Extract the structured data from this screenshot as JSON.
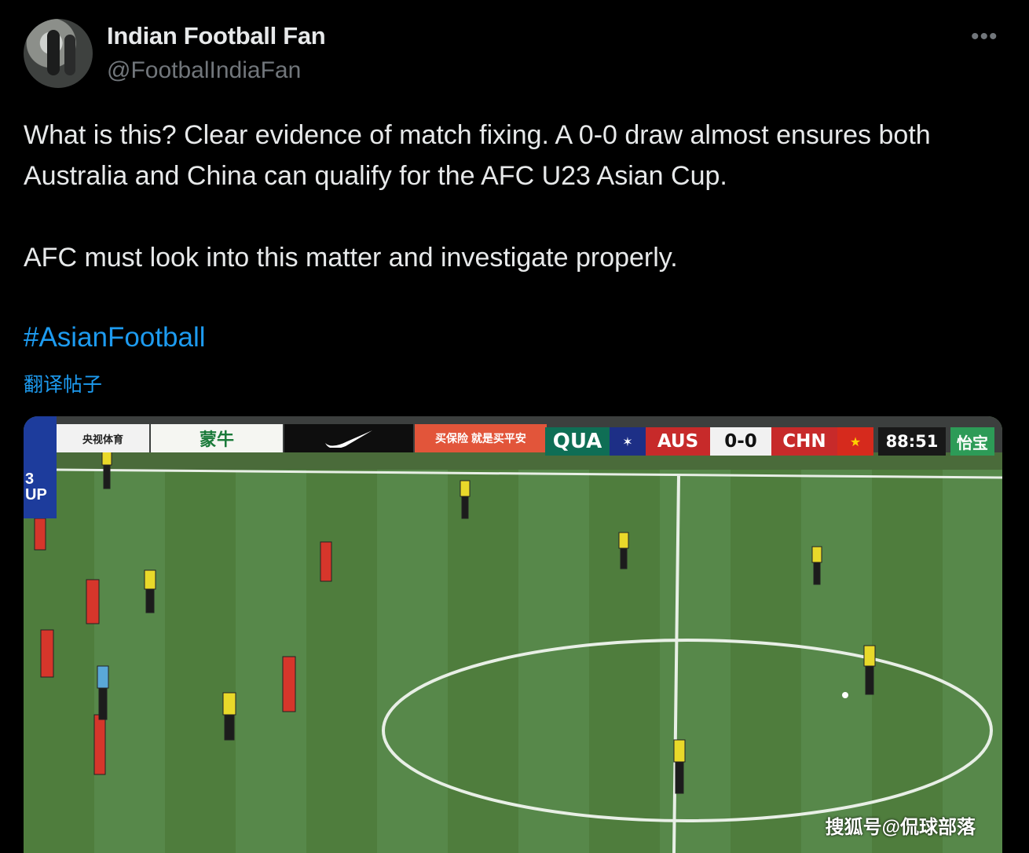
{
  "user": {
    "display_name": "Indian Football Fan",
    "handle": "@FootbalIndiaFan",
    "more_icon": "more-horizontal-icon"
  },
  "tweet": {
    "line1": "What is this? Clear evidence of match fixing. A 0-0 draw almost ensures both Australia and China can qualify for the AFC U23 Asian Cup.",
    "line2": "AFC must look into this matter and investigate properly.",
    "hashtag": "#AsianFootball",
    "translate": "翻译帖子"
  },
  "broadcast": {
    "badge_text": "3\nUP",
    "board_left": "央视体育",
    "board_mengniu": "蒙牛",
    "board_red": "买保险 就是买平安",
    "board_qua": "QUA",
    "home_team": "AUS",
    "score": "0-0",
    "away_team": "CHN",
    "clock": "88:51",
    "board_right": "怡宝"
  },
  "watermark": "搜狐号@侃球部落",
  "colors": {
    "link": "#1d9bf0",
    "muted": "#71767b",
    "text": "#e7e9ea",
    "pitch": "#4d7a3c",
    "aus_kit": "#e9d92a",
    "chn_kit": "#d6362b"
  }
}
